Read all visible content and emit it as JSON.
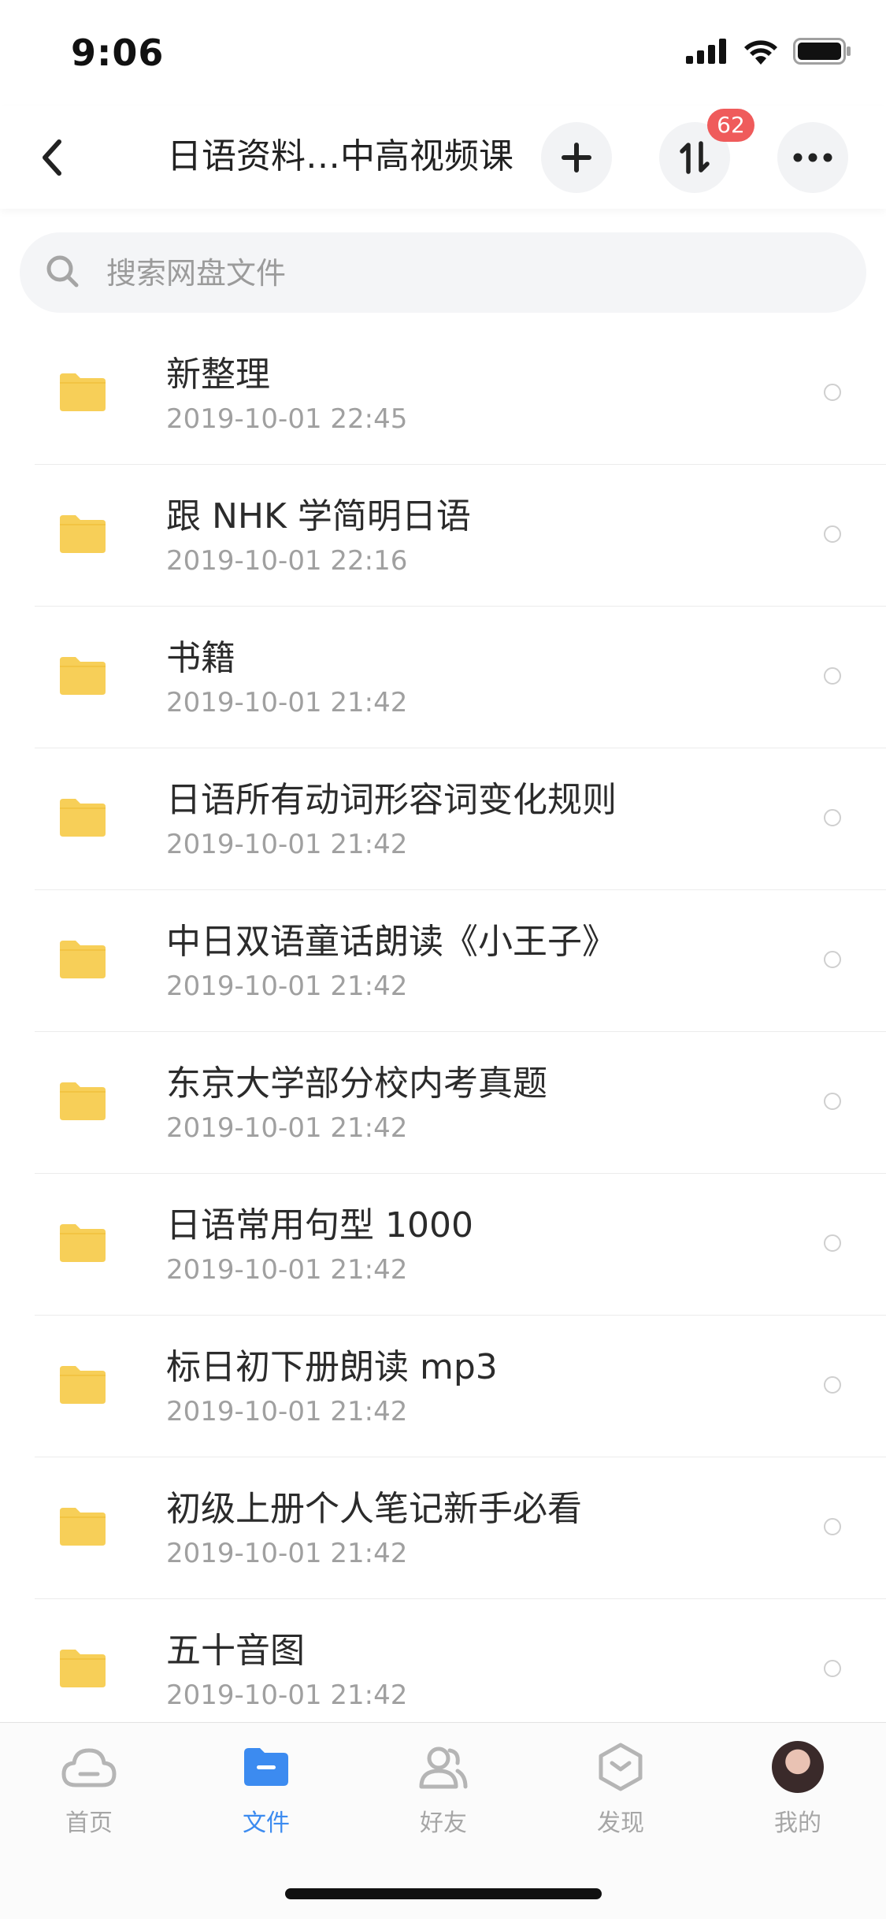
{
  "status_bar": {
    "time": "9:06"
  },
  "nav": {
    "title": "日语资料…中高视频课",
    "transfer_badge": "62",
    "icons": {
      "back": "chevron-left-icon",
      "add": "plus-icon",
      "transfer": "transfer-arrows-icon",
      "more": "more-dots-icon"
    }
  },
  "search": {
    "placeholder": "搜索网盘文件"
  },
  "files": [
    {
      "name": "新整理",
      "date": "2019-10-01 22:45"
    },
    {
      "name": "跟 NHK 学简明日语",
      "date": "2019-10-01 22:16"
    },
    {
      "name": "书籍",
      "date": "2019-10-01 21:42"
    },
    {
      "name": "日语所有动词形容词变化规则",
      "date": "2019-10-01 21:42"
    },
    {
      "name": "中日双语童话朗读《小王子》",
      "date": "2019-10-01 21:42"
    },
    {
      "name": "东京大学部分校内考真题",
      "date": "2019-10-01 21:42"
    },
    {
      "name": "日语常用句型 1000",
      "date": "2019-10-01 21:42"
    },
    {
      "name": "标日初下册朗读 mp3",
      "date": "2019-10-01 21:42"
    },
    {
      "name": "初级上册个人笔记新手必看",
      "date": "2019-10-01 21:42"
    },
    {
      "name": "五十音图",
      "date": "2019-10-01 21:42"
    }
  ],
  "tabs": [
    {
      "label": "首页",
      "icon": "cloud-icon",
      "active": false
    },
    {
      "label": "文件",
      "icon": "folder-icon",
      "active": true
    },
    {
      "label": "好友",
      "icon": "friends-icon",
      "active": false
    },
    {
      "label": "发现",
      "icon": "discover-icon",
      "active": false
    },
    {
      "label": "我的",
      "icon": "avatar",
      "active": false
    }
  ],
  "colors": {
    "accent": "#3c8bf0",
    "folder": "#f7cf58",
    "badge": "#ef5b5b"
  }
}
